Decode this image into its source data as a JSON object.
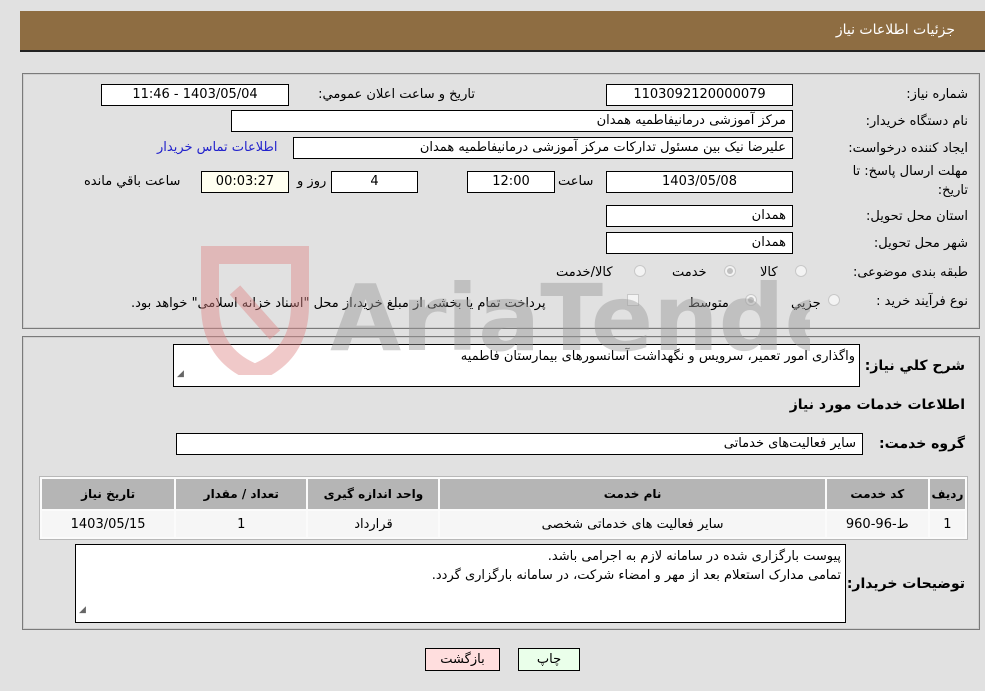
{
  "header": {
    "title": "جزئیات اطلاعات نیاز"
  },
  "info": {
    "need_number_label": "شماره نیاز:",
    "need_number": "1103092120000079",
    "announce_label": "تاریخ و ساعت اعلان عمومي:",
    "announce_value": "1403/05/04 - 11:46",
    "buyer_org_label": "نام دستگاه خریدار:",
    "buyer_org": "مرکز آموزشی درمانیفاطمیه همدان",
    "creator_label": "ایجاد کننده درخواست:",
    "creator": "علیرضا نیک بین مسئول تدارکات مرکز آموزشی درمانیفاطمیه همدان",
    "contact_link": "اطلاعات تماس خریدار",
    "deadline_label_1": "مهلت ارسال پاسخ: تا",
    "deadline_label_2": "تاریخ:",
    "deadline_date": "1403/05/08",
    "time_label": "ساعت",
    "deadline_time": "12:00",
    "days": "4",
    "days_label": "روز و",
    "remaining": "00:03:27",
    "remaining_label": "ساعت باقي مانده",
    "province_label": "استان محل تحویل:",
    "province": "همدان",
    "city_label": "شهر محل تحویل:",
    "city": "همدان",
    "category_label": "طبقه بندی موضوعی:",
    "category_options": [
      {
        "label": "کالا",
        "selected": false
      },
      {
        "label": "خدمت",
        "selected": true
      },
      {
        "label": "کالا/خدمت",
        "selected": false
      }
    ],
    "purchase_type_label": "نوع فرآیند خرید :",
    "purchase_options": [
      {
        "label": "جزيي",
        "selected": false
      },
      {
        "label": "متوسط",
        "selected": true
      }
    ],
    "treasury_checkbox_label": "پرداخت تمام یا بخشی از مبلغ خرید،از محل \"اسناد خزانه اسلامی\" خواهد بود.",
    "treasury_checked": false
  },
  "details": {
    "summary_label": "شرح کلي نیاز:",
    "summary": "واگذاری امور تعمیر، سرویس و نگهداشت آسانسورهای بیمارستان فاطمیه",
    "services_heading": "اطلاعات خدمات مورد نیاز",
    "service_group_label": "گروه خدمت:",
    "service_group": "سایر فعالیت‌های خدماتی",
    "table": {
      "headers": [
        "ردیف",
        "کد خدمت",
        "نام خدمت",
        "واحد اندازه گیری",
        "تعداد / مقدار",
        "تاریخ نیاز"
      ],
      "rows": [
        [
          "1",
          "ط-96-960",
          "سایر فعالیت های خدماتی شخصی",
          "قرارداد",
          "1",
          "1403/05/15"
        ]
      ]
    },
    "buyer_notes_label": "توضیحات خریدار:",
    "buyer_notes_line1": "پیوست بارگزاری شده در سامانه لازم به اجرامی باشد.",
    "buyer_notes_line2": "تمامی مدارک استعلام بعد از مهر و امضاء شرکت، در سامانه بارگزاری گردد."
  },
  "buttons": {
    "print": "چاپ",
    "back": "بازگشت"
  },
  "watermark": {
    "text": "AriaTender.neT"
  },
  "colors": {
    "header_bg": "#8e6d42",
    "print_bg": "#eaffea",
    "back_bg": "#ffdede",
    "link": "#2222cc"
  }
}
